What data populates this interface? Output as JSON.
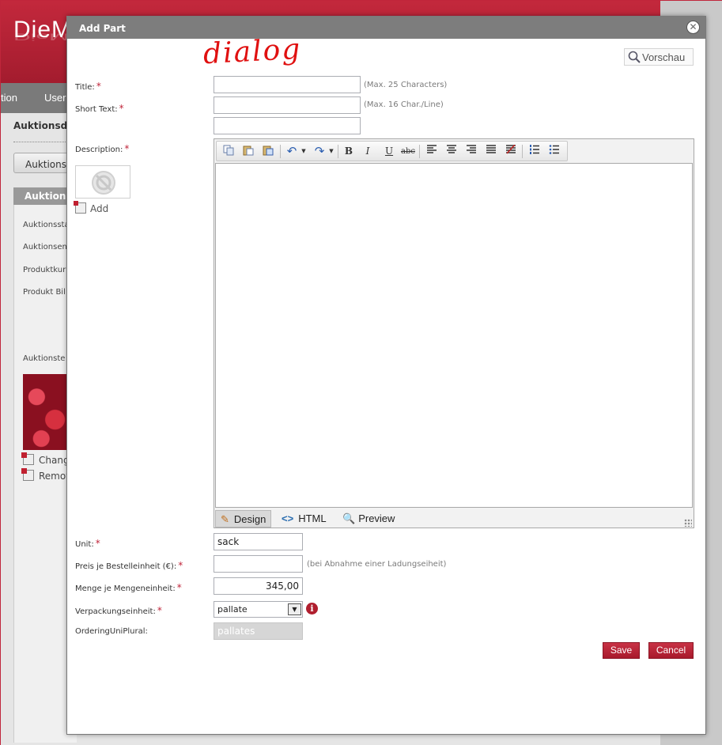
{
  "background": {
    "logo": "DieM",
    "nav": [
      "tion",
      "User"
    ],
    "section_title": "Auktionsde",
    "tab": "Auktions-",
    "panel_header": "Auktions",
    "labels": [
      "Auktionssta",
      "Auktionsen",
      "Produktkur",
      "Produkt Bil",
      "Auktionste"
    ],
    "actions": [
      "Chang",
      "Remov"
    ]
  },
  "dialog": {
    "title": "Add Part",
    "annotation": "dialog",
    "preview_button": "Vorschau",
    "fields": {
      "title": {
        "label": "Title:",
        "value": "",
        "hint": "(Max. 25 Characters)"
      },
      "short_text": {
        "label": "Short Text:",
        "value1": "",
        "value2": "",
        "hint": "(Max. 16 Char./Line)"
      },
      "description": {
        "label": "Description:",
        "add_label": "Add"
      },
      "unit": {
        "label": "Unit:",
        "value": "sack"
      },
      "price": {
        "label": "Preis je Bestelleinheit (€):",
        "value": "",
        "hint": "(bei Abnahme einer Ladungseiheit)"
      },
      "quantity": {
        "label": "Menge je Mengeneinheit:",
        "value": "345,00"
      },
      "packaging": {
        "label": "Verpackungseinheit:",
        "value": "pallate"
      },
      "plural": {
        "label": "OrderingUniPlural:",
        "value": "pallates"
      }
    },
    "editor": {
      "toolbar": {
        "copy": "copy-icon",
        "paste": "paste-icon",
        "paste_word": "paste-word-icon",
        "undo": "undo-icon",
        "redo": "redo-icon",
        "bold": "B",
        "italic": "I",
        "underline": "U",
        "strike": "abc"
      },
      "modes": {
        "design": "Design",
        "html": "HTML",
        "preview": "Preview"
      }
    },
    "buttons": {
      "save": "Save",
      "cancel": "Cancel"
    }
  }
}
